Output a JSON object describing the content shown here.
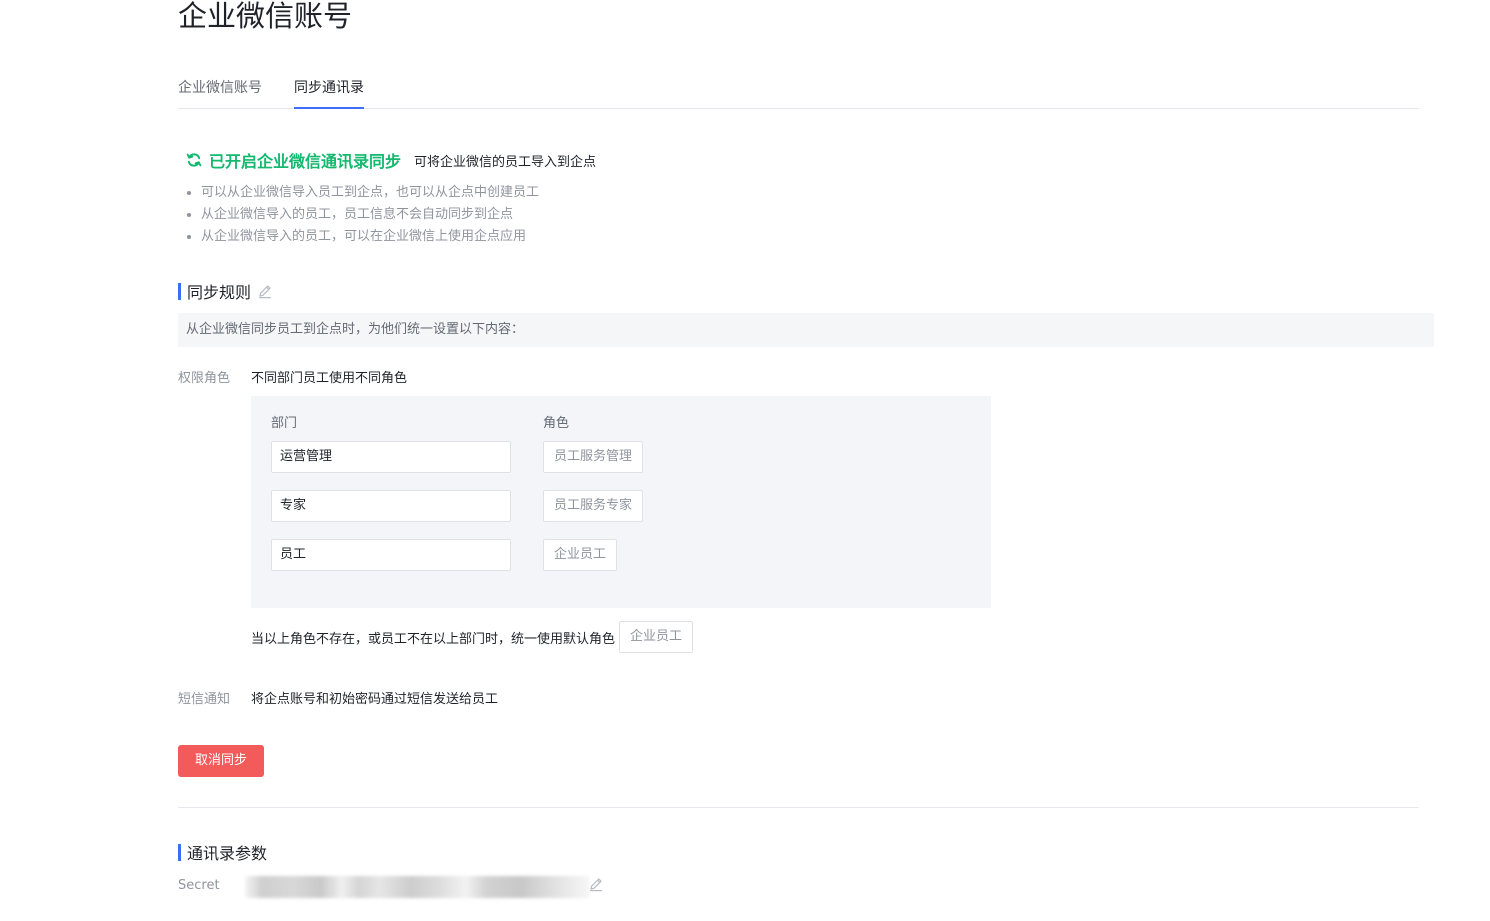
{
  "page": {
    "title": "企业微信账号"
  },
  "tabs": [
    {
      "label": "企业微信账号",
      "active": false
    },
    {
      "label": "同步通讯录",
      "active": true
    }
  ],
  "sync_status": {
    "icon": "refresh-icon",
    "title": "已开启企业微信通讯录同步",
    "description": "可将企业微信的员工导入到企点",
    "bullets": [
      "可以从企业微信导入员工到企点，也可以从企点中创建员工",
      "从企业微信导入的员工，员工信息不会自动同步到企点",
      "从企业微信导入的员工，可以在企业微信上使用企点应用"
    ]
  },
  "sync_rules": {
    "title": "同步规则",
    "tip": "从企业微信同步员工到企点时，为他们统一设置以下内容：",
    "permission_label": "权限角色",
    "permission_value": "不同部门员工使用不同角色",
    "col_department": "部门",
    "col_role": "角色",
    "mappings": [
      {
        "department": "运营管理",
        "role": "员工服务管理"
      },
      {
        "department": "专家",
        "role": "员工服务专家"
      },
      {
        "department": "员工",
        "role": "企业员工"
      }
    ],
    "default_text": "当以上角色不存在，或员工不在以上部门时，统一使用默认角色",
    "default_role": "企业员工",
    "sms_label": "短信通知",
    "sms_value": "将企点账号和初始密码通过短信发送给员工",
    "cancel_label": "取消同步"
  },
  "contacts_params": {
    "title": "通讯录参数",
    "secret_label": "Secret"
  },
  "colors": {
    "accent": "#3b6ef5",
    "success": "#14b86f",
    "danger": "#f35a5a",
    "panel": "#f4f5f8"
  }
}
